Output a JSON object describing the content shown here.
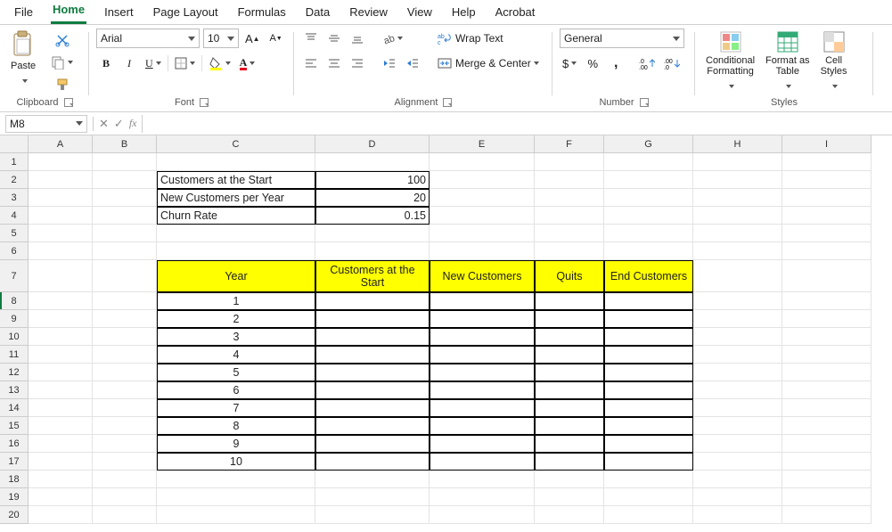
{
  "menu": {
    "items": [
      "File",
      "Home",
      "Insert",
      "Page Layout",
      "Formulas",
      "Data",
      "Review",
      "View",
      "Help",
      "Acrobat"
    ],
    "active": "Home"
  },
  "ribbon": {
    "clipboard": {
      "label": "Clipboard",
      "paste": "Paste"
    },
    "font": {
      "label": "Font",
      "name": "Arial",
      "size": "10"
    },
    "alignment": {
      "label": "Alignment",
      "wrap": "Wrap Text",
      "merge": "Merge & Center"
    },
    "number": {
      "label": "Number",
      "format": "General"
    },
    "styles": {
      "label": "Styles",
      "cond": "Conditional\nFormatting",
      "table": "Format as\nTable",
      "cell": "Cell\nStyles"
    }
  },
  "namebox": "M8",
  "fx": {
    "symbol": "fx",
    "value": ""
  },
  "columns": [
    {
      "id": "A",
      "w": 72
    },
    {
      "id": "B",
      "w": 72
    },
    {
      "id": "C",
      "w": 178
    },
    {
      "id": "D",
      "w": 128
    },
    {
      "id": "E",
      "w": 118
    },
    {
      "id": "F",
      "w": 78
    },
    {
      "id": "G",
      "w": 100
    },
    {
      "id": "H",
      "w": 100
    },
    {
      "id": "I",
      "w": 100
    }
  ],
  "params": {
    "c2": "Customers at the Start",
    "d2": "100",
    "c3": "New Customers per Year",
    "d3": "20",
    "c4": "Churn Rate",
    "d4": "0.15"
  },
  "headers": {
    "c": "Year",
    "d": "Customers at the Start",
    "e": "New Customers",
    "f": "Quits",
    "g": "End Customers"
  },
  "years": [
    "1",
    "2",
    "3",
    "4",
    "5",
    "6",
    "7",
    "8",
    "9",
    "10"
  ]
}
